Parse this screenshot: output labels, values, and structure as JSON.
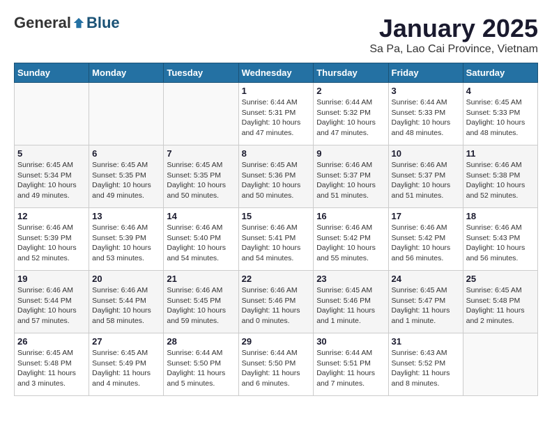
{
  "logo": {
    "general": "General",
    "blue": "Blue"
  },
  "header": {
    "month": "January 2025",
    "location": "Sa Pa, Lao Cai Province, Vietnam"
  },
  "weekdays": [
    "Sunday",
    "Monday",
    "Tuesday",
    "Wednesday",
    "Thursday",
    "Friday",
    "Saturday"
  ],
  "weeks": [
    [
      {
        "day": "",
        "info": ""
      },
      {
        "day": "",
        "info": ""
      },
      {
        "day": "",
        "info": ""
      },
      {
        "day": "1",
        "info": "Sunrise: 6:44 AM\nSunset: 5:31 PM\nDaylight: 10 hours\nand 47 minutes."
      },
      {
        "day": "2",
        "info": "Sunrise: 6:44 AM\nSunset: 5:32 PM\nDaylight: 10 hours\nand 47 minutes."
      },
      {
        "day": "3",
        "info": "Sunrise: 6:44 AM\nSunset: 5:33 PM\nDaylight: 10 hours\nand 48 minutes."
      },
      {
        "day": "4",
        "info": "Sunrise: 6:45 AM\nSunset: 5:33 PM\nDaylight: 10 hours\nand 48 minutes."
      }
    ],
    [
      {
        "day": "5",
        "info": "Sunrise: 6:45 AM\nSunset: 5:34 PM\nDaylight: 10 hours\nand 49 minutes."
      },
      {
        "day": "6",
        "info": "Sunrise: 6:45 AM\nSunset: 5:35 PM\nDaylight: 10 hours\nand 49 minutes."
      },
      {
        "day": "7",
        "info": "Sunrise: 6:45 AM\nSunset: 5:35 PM\nDaylight: 10 hours\nand 50 minutes."
      },
      {
        "day": "8",
        "info": "Sunrise: 6:45 AM\nSunset: 5:36 PM\nDaylight: 10 hours\nand 50 minutes."
      },
      {
        "day": "9",
        "info": "Sunrise: 6:46 AM\nSunset: 5:37 PM\nDaylight: 10 hours\nand 51 minutes."
      },
      {
        "day": "10",
        "info": "Sunrise: 6:46 AM\nSunset: 5:37 PM\nDaylight: 10 hours\nand 51 minutes."
      },
      {
        "day": "11",
        "info": "Sunrise: 6:46 AM\nSunset: 5:38 PM\nDaylight: 10 hours\nand 52 minutes."
      }
    ],
    [
      {
        "day": "12",
        "info": "Sunrise: 6:46 AM\nSunset: 5:39 PM\nDaylight: 10 hours\nand 52 minutes."
      },
      {
        "day": "13",
        "info": "Sunrise: 6:46 AM\nSunset: 5:39 PM\nDaylight: 10 hours\nand 53 minutes."
      },
      {
        "day": "14",
        "info": "Sunrise: 6:46 AM\nSunset: 5:40 PM\nDaylight: 10 hours\nand 54 minutes."
      },
      {
        "day": "15",
        "info": "Sunrise: 6:46 AM\nSunset: 5:41 PM\nDaylight: 10 hours\nand 54 minutes."
      },
      {
        "day": "16",
        "info": "Sunrise: 6:46 AM\nSunset: 5:42 PM\nDaylight: 10 hours\nand 55 minutes."
      },
      {
        "day": "17",
        "info": "Sunrise: 6:46 AM\nSunset: 5:42 PM\nDaylight: 10 hours\nand 56 minutes."
      },
      {
        "day": "18",
        "info": "Sunrise: 6:46 AM\nSunset: 5:43 PM\nDaylight: 10 hours\nand 56 minutes."
      }
    ],
    [
      {
        "day": "19",
        "info": "Sunrise: 6:46 AM\nSunset: 5:44 PM\nDaylight: 10 hours\nand 57 minutes."
      },
      {
        "day": "20",
        "info": "Sunrise: 6:46 AM\nSunset: 5:44 PM\nDaylight: 10 hours\nand 58 minutes."
      },
      {
        "day": "21",
        "info": "Sunrise: 6:46 AM\nSunset: 5:45 PM\nDaylight: 10 hours\nand 59 minutes."
      },
      {
        "day": "22",
        "info": "Sunrise: 6:46 AM\nSunset: 5:46 PM\nDaylight: 11 hours\nand 0 minutes."
      },
      {
        "day": "23",
        "info": "Sunrise: 6:45 AM\nSunset: 5:46 PM\nDaylight: 11 hours\nand 1 minute."
      },
      {
        "day": "24",
        "info": "Sunrise: 6:45 AM\nSunset: 5:47 PM\nDaylight: 11 hours\nand 1 minute."
      },
      {
        "day": "25",
        "info": "Sunrise: 6:45 AM\nSunset: 5:48 PM\nDaylight: 11 hours\nand 2 minutes."
      }
    ],
    [
      {
        "day": "26",
        "info": "Sunrise: 6:45 AM\nSunset: 5:48 PM\nDaylight: 11 hours\nand 3 minutes."
      },
      {
        "day": "27",
        "info": "Sunrise: 6:45 AM\nSunset: 5:49 PM\nDaylight: 11 hours\nand 4 minutes."
      },
      {
        "day": "28",
        "info": "Sunrise: 6:44 AM\nSunset: 5:50 PM\nDaylight: 11 hours\nand 5 minutes."
      },
      {
        "day": "29",
        "info": "Sunrise: 6:44 AM\nSunset: 5:50 PM\nDaylight: 11 hours\nand 6 minutes."
      },
      {
        "day": "30",
        "info": "Sunrise: 6:44 AM\nSunset: 5:51 PM\nDaylight: 11 hours\nand 7 minutes."
      },
      {
        "day": "31",
        "info": "Sunrise: 6:43 AM\nSunset: 5:52 PM\nDaylight: 11 hours\nand 8 minutes."
      },
      {
        "day": "",
        "info": ""
      }
    ]
  ]
}
